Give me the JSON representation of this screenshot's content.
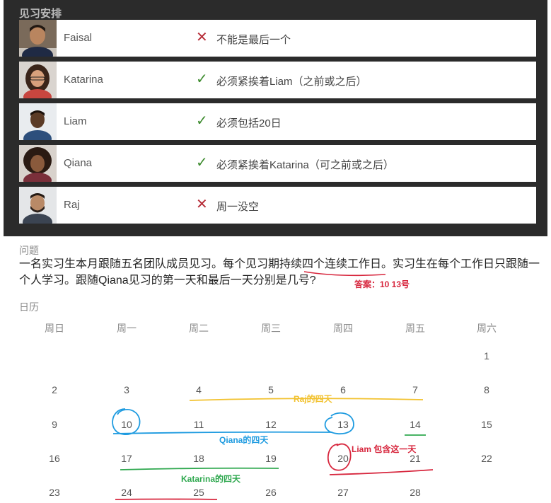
{
  "panel": {
    "title": "见习安排",
    "rows": [
      {
        "name": "Faisal",
        "ok": false,
        "mark": "✕",
        "rule": "不能是最后一个"
      },
      {
        "name": "Katarina",
        "ok": true,
        "mark": "✓",
        "rule": "必须紧挨着Liam（之前或之后）"
      },
      {
        "name": "Liam",
        "ok": true,
        "mark": "✓",
        "rule": "必须包括20日"
      },
      {
        "name": "Qiana",
        "ok": true,
        "mark": "✓",
        "rule": "必须紧挨着Katarina（可之前或之后）"
      },
      {
        "name": "Raj",
        "ok": false,
        "mark": "✕",
        "rule": "周一没空"
      }
    ]
  },
  "question": {
    "label": "问题",
    "text": "一名实习生本月跟随五名团队成员见习。每个见习期持续四个连续工作日。实习生在每个工作日只跟随一个人学习。跟随Qiana见习的第一天和最后一天分别是几号?",
    "answer_note": "答案：10   13号"
  },
  "calendar": {
    "label": "日历",
    "weekdays": [
      "周日",
      "周一",
      "周二",
      "周三",
      "周四",
      "周五",
      "周六"
    ],
    "weeks": [
      [
        "",
        "",
        "",
        "",
        "",
        "",
        "1"
      ],
      [
        "2",
        "3",
        "4",
        "5",
        "6",
        "7",
        "8"
      ],
      [
        "9",
        "10",
        "11",
        "12",
        "13",
        "14",
        "15"
      ],
      [
        "16",
        "17",
        "18",
        "19",
        "20",
        "21",
        "22"
      ],
      [
        "23",
        "24",
        "25",
        "26",
        "27",
        "28",
        ""
      ]
    ]
  },
  "annotations": {
    "raj": "Raj的四天",
    "qiana": "Qiana的四天",
    "liam": "Liam 包含这一天",
    "katarina": "Katarina的四天"
  },
  "colors": {
    "panel_bg": "#2b2b2b",
    "x_mark": "#b72e39",
    "check_mark": "#3d8b2e",
    "ann_red": "#d7263d",
    "ann_blue": "#1e9be0",
    "ann_yellow": "#f2c230",
    "ann_green": "#2fa84f"
  }
}
